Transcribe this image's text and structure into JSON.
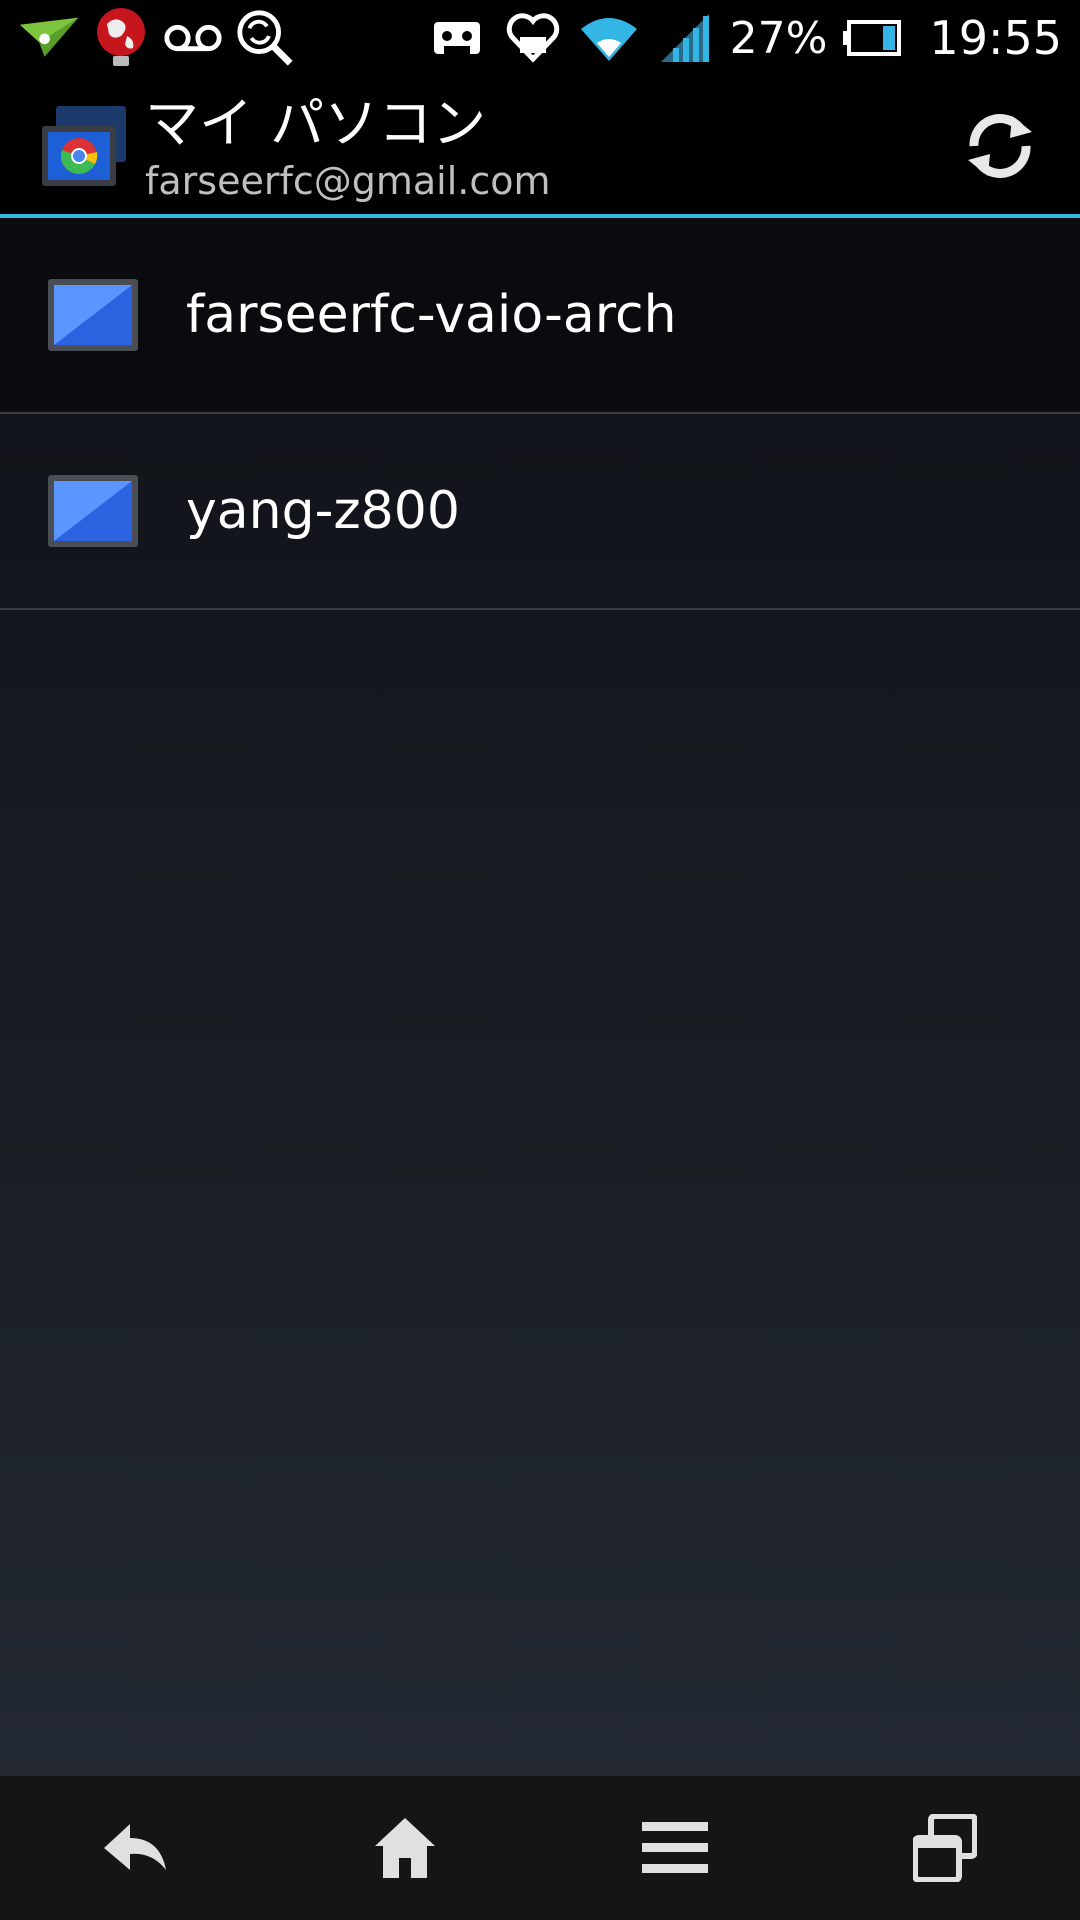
{
  "status_bar": {
    "left_icons": [
      "airdroid-icon",
      "globe-bulb-icon",
      "voicemail-icon",
      "sync-search-icon"
    ],
    "right_icons": [
      "cassette-icon",
      "health-icon",
      "wifi-icon",
      "signal-icon",
      "battery-icon"
    ],
    "battery_percent": "27%",
    "time": "19:55"
  },
  "action_bar": {
    "title": "マイ パソコン",
    "subtitle": "farseerfc@gmail.com",
    "refresh_icon": "refresh-icon"
  },
  "hosts": [
    {
      "name": "farseerfc-vaio-arch"
    },
    {
      "name": "yang-z800"
    }
  ],
  "nav_bar": {
    "buttons": [
      "back-icon",
      "home-icon",
      "menu-icon",
      "recent-apps-icon"
    ]
  },
  "colors": {
    "accent": "#33b5e5",
    "screen_blue": "#3a7bfd"
  }
}
